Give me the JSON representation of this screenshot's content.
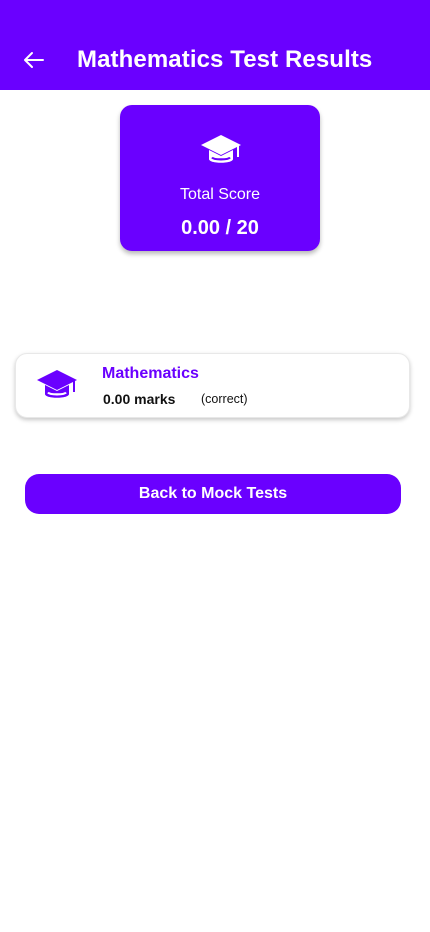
{
  "colors": {
    "primary": "#6a00ff",
    "background": "#ffffff",
    "text_dark": "#111111"
  },
  "header": {
    "title": "Mathematics Test Results",
    "back_icon": "arrow-left-icon"
  },
  "score_card": {
    "icon": "graduation-cap-icon",
    "label": "Total Score",
    "value": "0.00 / 20"
  },
  "subjects": [
    {
      "icon": "graduation-cap-icon",
      "name": "Mathematics",
      "marks": "0.00 marks",
      "status": "(correct)"
    }
  ],
  "actions": {
    "back_to_tests_label": "Back to Mock Tests"
  }
}
